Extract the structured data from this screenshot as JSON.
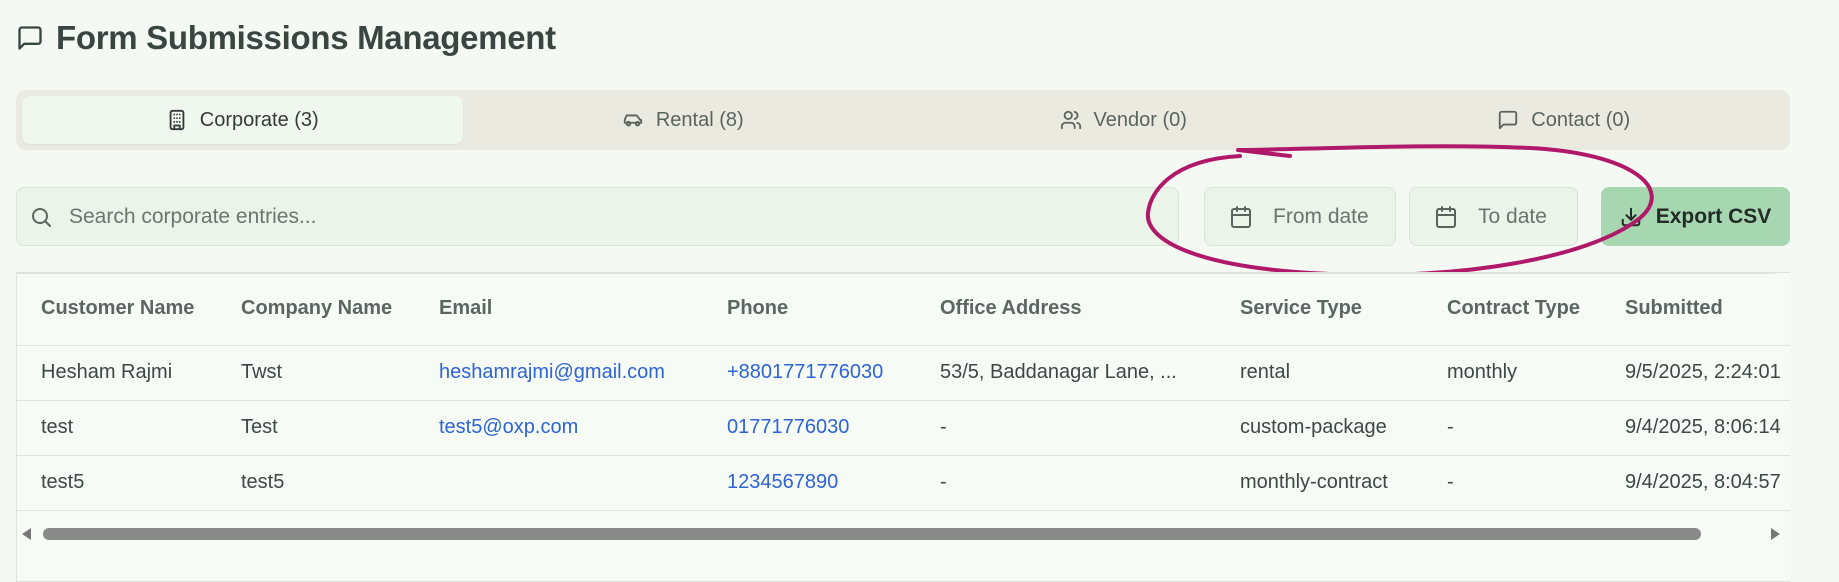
{
  "header": {
    "title": "Form Submissions Management",
    "icon": "message-square-icon"
  },
  "tabs": [
    {
      "label": "Corporate (3)",
      "icon": "building-icon",
      "active": true
    },
    {
      "label": "Rental (8)",
      "icon": "car-icon",
      "active": false
    },
    {
      "label": "Vendor (0)",
      "icon": "users-icon",
      "active": false
    },
    {
      "label": "Contact (0)",
      "icon": "message-square-icon",
      "active": false
    }
  ],
  "filters": {
    "search_placeholder": "Search corporate entries...",
    "from_date": "From date",
    "to_date": "To date",
    "export_label": "Export CSV"
  },
  "table": {
    "columns": [
      "Customer Name",
      "Company Name",
      "Email",
      "Phone",
      "Office Address",
      "Service Type",
      "Contract Type",
      "Submitted"
    ],
    "rows": [
      [
        "Hesham Rajmi",
        "Twst",
        "heshamrajmi@gmail.com",
        "+8801771776030",
        "53/5, Baddanagar Lane, ...",
        "rental",
        "monthly",
        "9/5/2025, 2:24:01"
      ],
      [
        "test",
        "Test",
        "test5@oxp.com",
        "01771776030",
        "-",
        "custom-package",
        "-",
        "9/4/2025, 8:06:14"
      ],
      [
        "test5",
        "test5",
        "",
        "1234567890",
        "-",
        "monthly-contract",
        "-",
        "9/4/2025, 8:04:57"
      ]
    ]
  },
  "colors": {
    "accent": "#a7d7b0",
    "link": "#2e63d6",
    "annotation": "#b0196a"
  }
}
